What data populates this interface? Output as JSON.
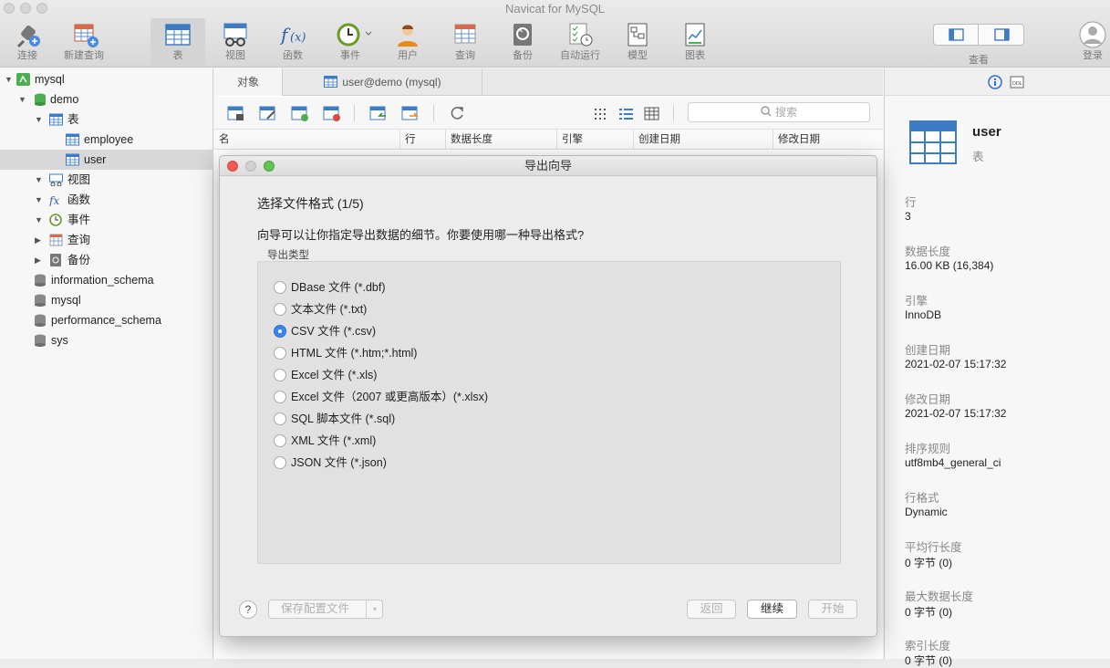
{
  "app": {
    "title": "Navicat for MySQL"
  },
  "toolbar": {
    "connect": "连接",
    "new_query": "新建查询",
    "table": "表",
    "view": "视图",
    "function": "函数",
    "event": "事件",
    "user": "用户",
    "query": "查询",
    "backup": "备份",
    "automation": "自动运行",
    "model": "模型",
    "chart": "图表",
    "view_toggle": "查看",
    "login": "登录"
  },
  "sidebar": {
    "items": [
      {
        "label": "mysql",
        "icon": "connection-icon"
      },
      {
        "label": "demo",
        "icon": "database-icon"
      },
      {
        "label": "表",
        "icon": "table-folder-icon"
      },
      {
        "label": "employee",
        "icon": "table-icon"
      },
      {
        "label": "user",
        "icon": "table-icon",
        "selected": true
      },
      {
        "label": "视图",
        "icon": "view-icon"
      },
      {
        "label": "函数",
        "icon": "function-icon"
      },
      {
        "label": "事件",
        "icon": "event-icon"
      },
      {
        "label": "查询",
        "icon": "query-icon"
      },
      {
        "label": "备份",
        "icon": "backup-icon"
      },
      {
        "label": "information_schema",
        "icon": "database-icon"
      },
      {
        "label": "mysql",
        "icon": "database-icon"
      },
      {
        "label": "performance_schema",
        "icon": "database-icon"
      },
      {
        "label": "sys",
        "icon": "database-icon"
      }
    ]
  },
  "main": {
    "tabs": [
      {
        "label": "对象"
      },
      {
        "label": "user@demo (mysql)"
      }
    ],
    "search_placeholder": "搜索",
    "columns": [
      "名",
      "行",
      "数据长度",
      "引擎",
      "创建日期",
      "修改日期"
    ]
  },
  "dialog": {
    "title": "导出向导",
    "heading": "选择文件格式 (1/5)",
    "description": "向导可以让你指定导出数据的细节。你要使用哪一种导出格式?",
    "group_label": "导出类型",
    "formats": [
      {
        "label": "DBase 文件 (*.dbf)",
        "selected": false
      },
      {
        "label": "文本文件 (*.txt)",
        "selected": false
      },
      {
        "label": "CSV 文件 (*.csv)",
        "selected": true
      },
      {
        "label": "HTML 文件 (*.htm;*.html)",
        "selected": false
      },
      {
        "label": "Excel 文件 (*.xls)",
        "selected": false
      },
      {
        "label": "Excel 文件（2007 或更高版本）(*.xlsx)",
        "selected": false
      },
      {
        "label": "SQL 脚本文件 (*.sql)",
        "selected": false
      },
      {
        "label": "XML 文件 (*.xml)",
        "selected": false
      },
      {
        "label": "JSON 文件 (*.json)",
        "selected": false
      }
    ],
    "help": "?",
    "save_profile": "保存配置文件",
    "back": "返回",
    "continue": "继续",
    "start": "开始"
  },
  "details": {
    "name": "user",
    "type": "表",
    "props": [
      {
        "label": "行",
        "value": "3"
      },
      {
        "label": "数据长度",
        "value": "16.00 KB (16,384)"
      },
      {
        "label": "引擎",
        "value": "InnoDB"
      },
      {
        "label": "创建日期",
        "value": "2021-02-07 15:17:32"
      },
      {
        "label": "修改日期",
        "value": "2021-02-07 15:17:32"
      },
      {
        "label": "排序规则",
        "value": "utf8mb4_general_ci"
      },
      {
        "label": "行格式",
        "value": "Dynamic"
      },
      {
        "label": "平均行长度",
        "value": "0 字节 (0)"
      },
      {
        "label": "最大数据长度",
        "value": "0 字节 (0)"
      },
      {
        "label": "索引长度",
        "value": "0 字节 (0)"
      }
    ]
  },
  "colors": {
    "accent": "#3a84f0",
    "table_blue": "#3d7bc4",
    "db_green": "#4caf50"
  }
}
